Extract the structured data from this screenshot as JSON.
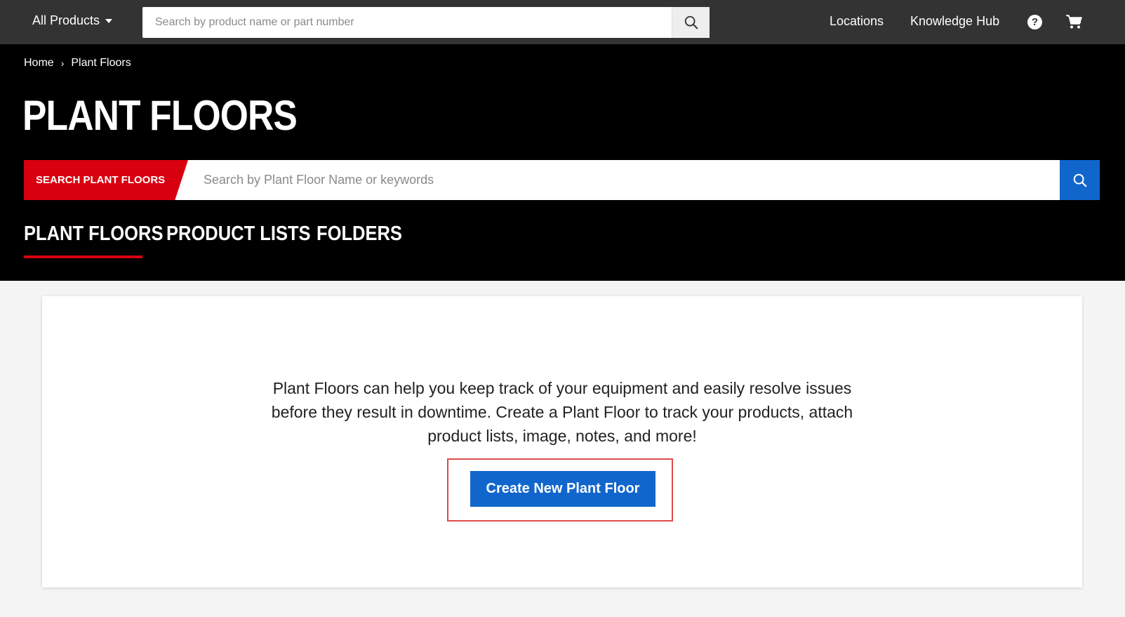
{
  "topbar": {
    "all_products_label": "All Products",
    "search_placeholder": "Search by product name or part number",
    "links": {
      "locations": "Locations",
      "knowledge_hub": "Knowledge Hub"
    },
    "help_glyph": "?",
    "icons": [
      "chevron-down-icon",
      "search-icon",
      "help-icon",
      "cart-icon"
    ]
  },
  "breadcrumb": {
    "home": "Home",
    "separator": "›",
    "current": "Plant Floors"
  },
  "page": {
    "title": "PLANT FLOORS"
  },
  "plant_floor_search": {
    "label": "SEARCH PLANT FLOORS",
    "placeholder": "Search by Plant Floor Name or keywords"
  },
  "tabs": [
    {
      "label": "PLANT FLOORS",
      "active": true
    },
    {
      "label": "PRODUCT LISTS",
      "active": false
    },
    {
      "label": "FOLDERS",
      "active": false
    }
  ],
  "card": {
    "intro_text": "Plant Floors can help you keep track of your equipment and easily resolve issues before they result in downtime. Create a Plant Floor to track your products, attach product lists, image, notes, and more!",
    "create_button_label": "Create New Plant Floor"
  },
  "colors": {
    "topbar_bg": "#333333",
    "hero_bg": "#000000",
    "accent_red": "#d8000f",
    "accent_blue": "#1166cc",
    "highlight_border": "#e04b4b",
    "page_bg": "#f4f4f4"
  }
}
